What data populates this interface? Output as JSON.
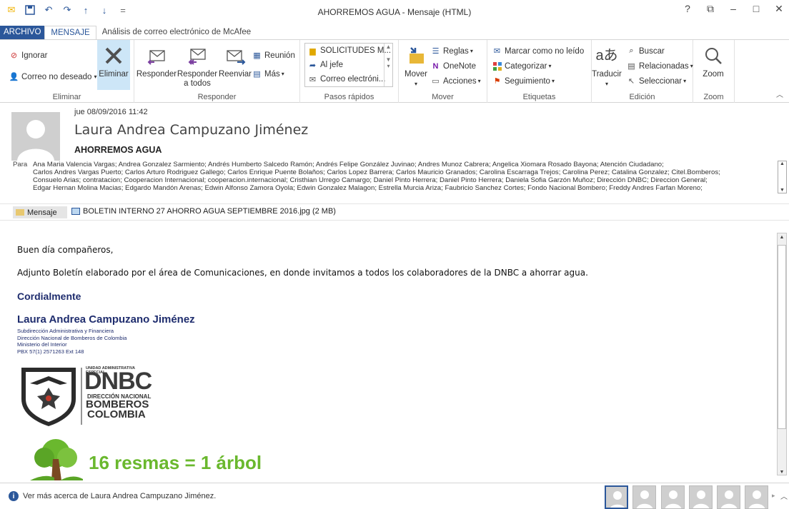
{
  "window": {
    "title": "AHORREMOS AGUA - Mensaje (HTML)",
    "controls": [
      "?",
      "⧉",
      "–",
      "□",
      "✕"
    ]
  },
  "tabs": [
    "ARCHIVO",
    "MENSAJE",
    "Análisis de correo electrónico de McAfee"
  ],
  "ribbon": {
    "delete_group": {
      "label": "Eliminar",
      "ignore": "Ignorar",
      "junk": "Correo no deseado",
      "delete": "Eliminar"
    },
    "respond_group": {
      "label": "Responder",
      "reply": "Responder",
      "reply_all_1": "Responder",
      "reply_all_2": "a todos",
      "forward": "Reenviar",
      "meeting": "Reunión",
      "more": "Más"
    },
    "quicksteps_group": {
      "label": "Pasos rápidos",
      "items": [
        "SOLICITUDES M...",
        "Al jefe",
        "Correo electróni..."
      ]
    },
    "move_group": {
      "label": "Mover",
      "move": "Mover",
      "rules": "Reglas",
      "onenote": "OneNote",
      "actions": "Acciones"
    },
    "tags_group": {
      "label": "Etiquetas",
      "mark_unread": "Marcar como no leído",
      "categorize": "Categorizar",
      "followup": "Seguimiento"
    },
    "edit_group": {
      "label": "Edición",
      "translate": "Traducir",
      "find": "Buscar",
      "related": "Relacionadas",
      "select": "Seleccionar"
    },
    "zoom_group": {
      "label": "Zoom",
      "zoom": "Zoom"
    }
  },
  "message": {
    "date": "jue 08/09/2016 11:42",
    "sender": "Laura Andrea Campuzano Jiménez",
    "subject": "AHORREMOS AGUA",
    "to_label": "Para",
    "recipients": [
      "Ana Maria Valencia Vargas; Andrea Gonzalez Sarmiento; Andrés  Humberto Salcedo Ramón; Andrés Felipe González Juvinao; Andres Munoz Cabrera; Angelica Xiomara Rosado Bayona; Atención  Ciudadano;",
      "Carlos Andres Vargas Puerto; Carlos Arturo Rodriguez Gallego; Carlos Enrique Puente Bolaños; Carlos Lopez Barrera; Carlos Mauricio  Granados; Carolina Escarraga Trejos; Carolina Perez; Catalina Gonzalez; Citel.Bomberos;",
      "Consuelo Arias; contratacion; Cooperacion Internacional; cooperacion.internacional; Cristhian Urrego Camargo; Daniel  Pinto Herrera; Daniel Pinto Herrera; Daniela Sofia Garzón Muñoz; Dirección DNBC; Direccion General;",
      "Edgar Hernan Molina Macias; Edgardo Mandón Arenas; Edwin Alfonso Zamora Oyola; Edwin Gonzalez Malagon; Estrella Murcia Ariza; Faubricio Sanchez Cortes; Fondo Nacional Bombero; Freddy Andres Farfan Moreno;"
    ],
    "message_tab": "Mensaje",
    "attachment": "BOLETIN INTERNO 27 AHORRO AGUA SEPTIEMBRE 2016.jpg (2 MB)"
  },
  "body": {
    "greeting": "Buen día compañeros,",
    "paragraph": "Adjunto Boletín elaborado por el área de Comunicaciones, en donde invitamos a todos los colaboradores de la DNBC a ahorrar agua.",
    "closing": "Cordialmente",
    "sig_name": "Laura Andrea Campuzano Jiménez",
    "sig_lines": [
      "Subdirección Administrativa y Financiera",
      "Dirección Nacional de Bomberos de Colombia",
      "Ministerio del Interior",
      "PBX 57(1) 2571263 Ext 148"
    ],
    "logo": {
      "top": "UNIDAD ADMINISTRATIVA ESPECIAL",
      "dnbc": "DNBC",
      "l1": "DIRECCIÓN NACIONAL",
      "l2": "BOMBEROS",
      "l3": "COLOMBIA"
    },
    "banner": "16 resmas = 1 árbol"
  },
  "status": {
    "text": "Ver más acerca de Laura Andrea Campuzano Jiménez."
  },
  "colors": {
    "accent": "#2b579a",
    "signature": "#1f2d6e",
    "banner_green": "#6ab82e"
  }
}
